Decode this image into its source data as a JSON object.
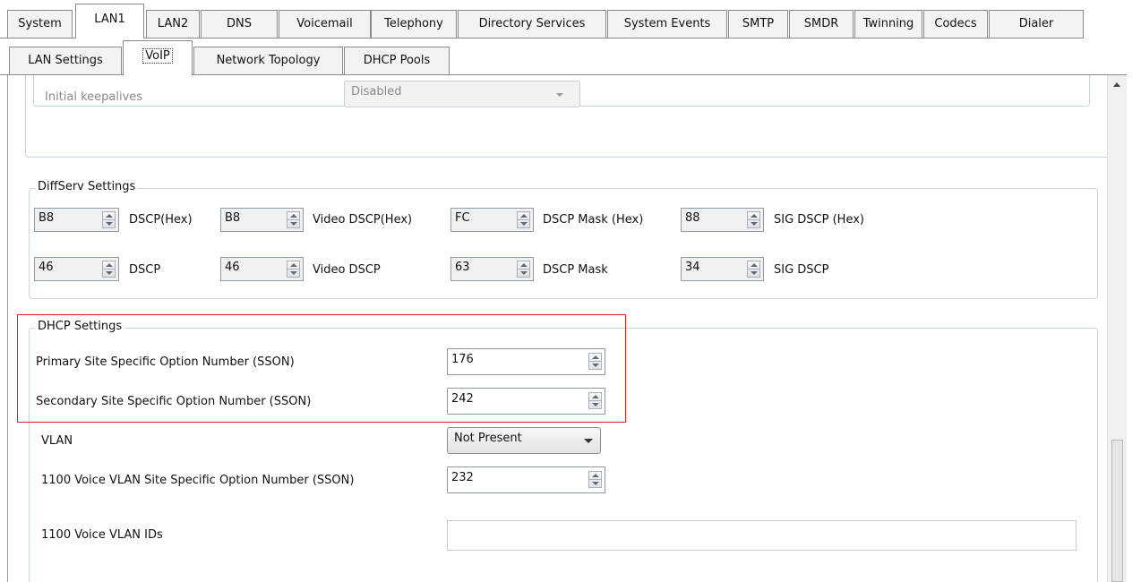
{
  "tabs": [
    "System",
    "LAN1",
    "LAN2",
    "DNS",
    "Voicemail",
    "Telephony",
    "Directory Services",
    "System Events",
    "SMTP",
    "SMDR",
    "Twinning",
    "Codecs",
    "Dialer"
  ],
  "subtabs": [
    "LAN Settings",
    "VoIP",
    "Network Topology",
    "DHCP Pools"
  ],
  "initial_keepalives": {
    "label": "Initial keepalives",
    "value": "Disabled"
  },
  "diffserv": {
    "title": "DiffServ Settings",
    "row1": [
      {
        "value": "B8",
        "label": "DSCP(Hex)"
      },
      {
        "value": "B8",
        "label": "Video DSCP(Hex)"
      },
      {
        "value": "FC",
        "label": "DSCP Mask (Hex)"
      },
      {
        "value": "88",
        "label": "SIG DSCP (Hex)"
      }
    ],
    "row2": [
      {
        "value": "46",
        "label": "DSCP"
      },
      {
        "value": "46",
        "label": "Video DSCP"
      },
      {
        "value": "63",
        "label": "DSCP Mask"
      },
      {
        "value": "34",
        "label": "SIG DSCP"
      }
    ]
  },
  "dhcp": {
    "title": "DHCP Settings",
    "primary": {
      "label": "Primary Site Specific Option Number (SSON)",
      "value": "176"
    },
    "secondary": {
      "label": "Secondary Site Specific Option Number (SSON)",
      "value": "242"
    },
    "vlan": {
      "label": "VLAN",
      "value": "Not Present"
    },
    "voice_vlan_sson": {
      "label": "1100 Voice VLAN Site Specific Option Number (SSON)",
      "value": "232"
    },
    "voice_vlan_ids": {
      "label": "1100 Voice VLAN IDs",
      "value": ""
    }
  }
}
